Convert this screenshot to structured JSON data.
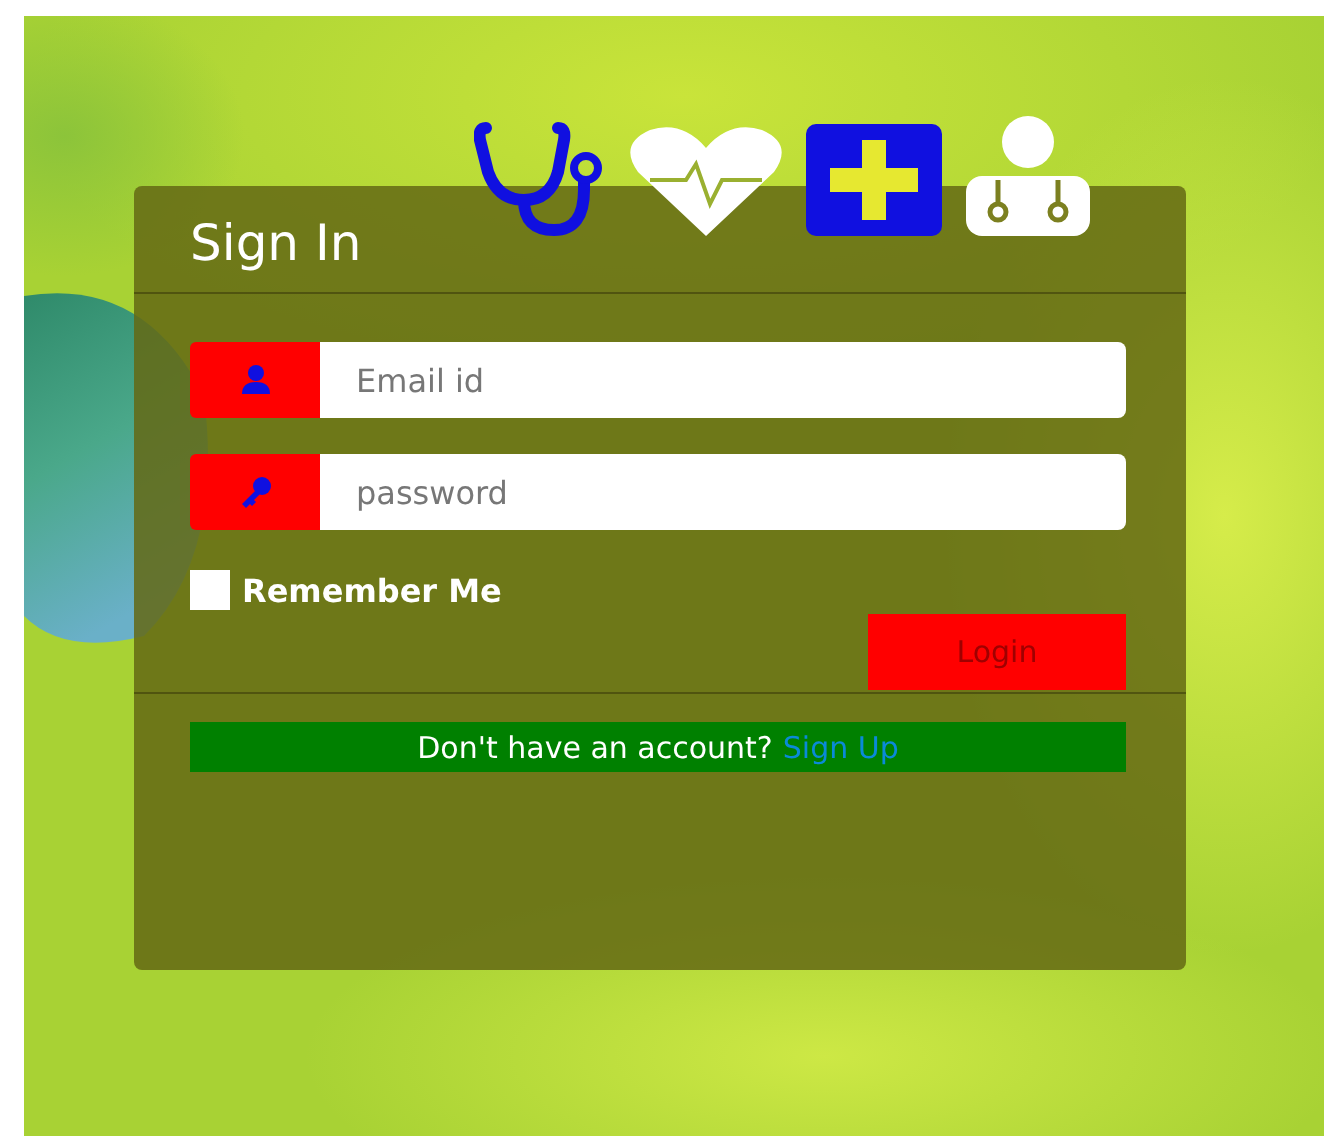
{
  "title": "Sign In",
  "fields": [
    {
      "kind": "email",
      "placeholder": "Email id"
    },
    {
      "kind": "password",
      "placeholder": "password"
    }
  ],
  "remember": {
    "label": "Remember Me",
    "checked": false
  },
  "login_button": "Login",
  "signup": {
    "text": "Don't have an account?",
    "link": "Sign Up"
  }
}
